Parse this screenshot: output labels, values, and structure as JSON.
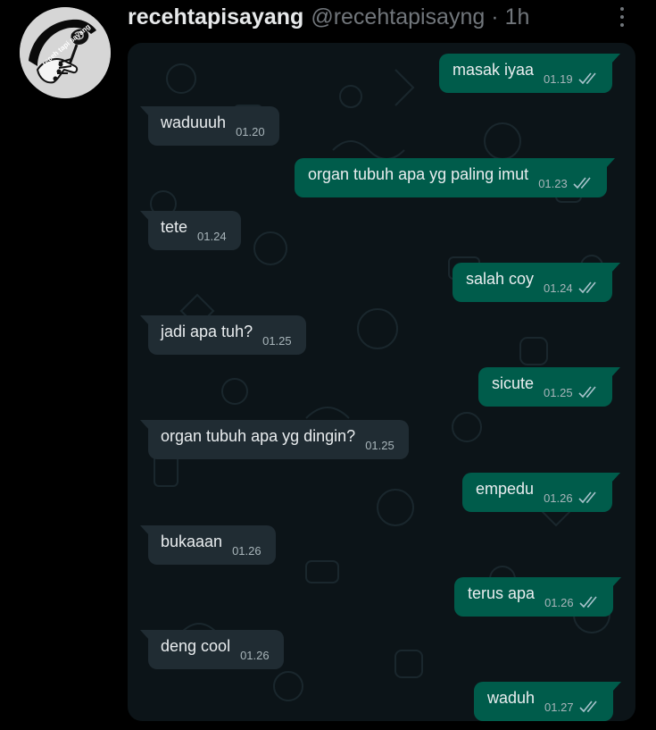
{
  "tweet": {
    "display_name": "recehtapisayang",
    "handle": "@recehtapisayng",
    "separator": "·",
    "time": "1h",
    "avatar_text": "receh tapi sayang"
  },
  "chat": {
    "messages": [
      {
        "side": "out",
        "text": "masak iyaa",
        "time": "01.19",
        "read": true
      },
      {
        "side": "in",
        "text": "waduuuh",
        "time": "01.20"
      },
      {
        "side": "out",
        "text": "organ tubuh apa yg paling imut",
        "time": "01.23",
        "read": true
      },
      {
        "side": "in",
        "text": "tete",
        "time": "01.24"
      },
      {
        "side": "out",
        "text": "salah coy",
        "time": "01.24",
        "read": true
      },
      {
        "side": "in",
        "text": "jadi apa tuh?",
        "time": "01.25"
      },
      {
        "side": "out",
        "text": "sicute",
        "time": "01.25",
        "read": true
      },
      {
        "side": "in",
        "text": "organ tubuh apa yg dingin?",
        "time": "01.25"
      },
      {
        "side": "out",
        "text": "empedu",
        "time": "01.26",
        "read": true
      },
      {
        "side": "in",
        "text": "bukaaan",
        "time": "01.26"
      },
      {
        "side": "out",
        "text": "terus apa",
        "time": "01.26",
        "read": true
      },
      {
        "side": "in",
        "text": "deng cool",
        "time": "01.26"
      },
      {
        "side": "out",
        "text": "waduh",
        "time": "01.27",
        "read": true
      }
    ]
  },
  "colors": {
    "page_bg": "#000000",
    "chat_bg": "#0c1418",
    "incoming_bubble": "#202c33",
    "outgoing_bubble": "#005c4b",
    "tick_read": "#a8c3cc"
  },
  "icons": {
    "more": "more-vertical-icon",
    "ticks": "double-check-icon",
    "avatar": "rose-hand-logo"
  }
}
